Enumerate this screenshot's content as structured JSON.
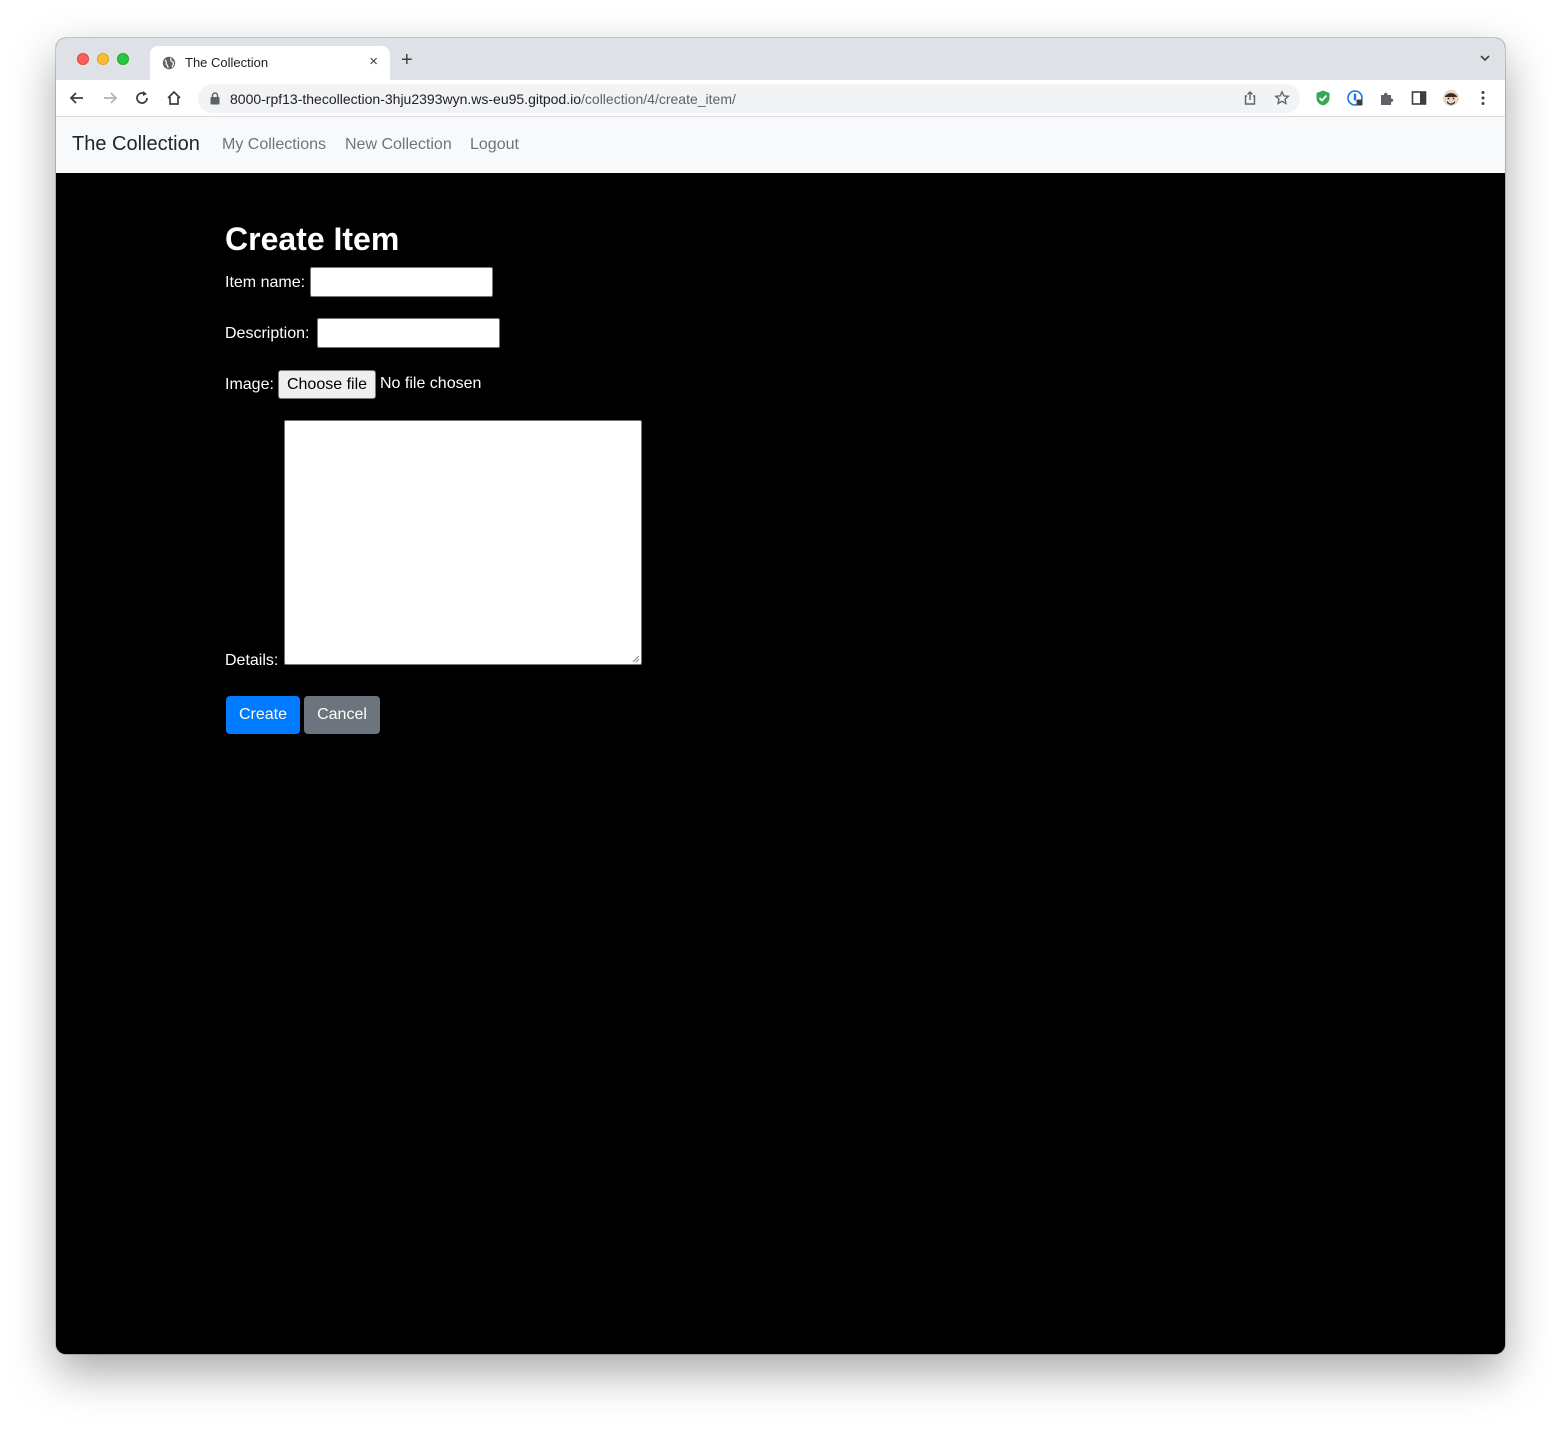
{
  "browser": {
    "tab_title": "The Collection",
    "url_host": "8000-rpf13-thecollection-3hju2393wyn.ws-eu95.gitpod.io",
    "url_path": "/collection/4/create_item/",
    "tab_close_glyph": "×",
    "new_tab_glyph": "+"
  },
  "navbar": {
    "brand": "The Collection",
    "links": [
      "My Collections",
      "New Collection",
      "Logout"
    ]
  },
  "form": {
    "title": "Create Item",
    "item_name_label": "Item name:",
    "item_name_value": "",
    "description_label": "Description:",
    "description_value": "",
    "image_label": "Image:",
    "choose_file_label": "Choose file",
    "file_status": "No file chosen",
    "details_label": "Details:",
    "details_value": "",
    "create_label": "Create",
    "cancel_label": "Cancel"
  },
  "colors": {
    "primary": "#007bff",
    "secondary": "#6c757d",
    "page_background": "#000000",
    "navbar_background": "#f8f9fa"
  }
}
